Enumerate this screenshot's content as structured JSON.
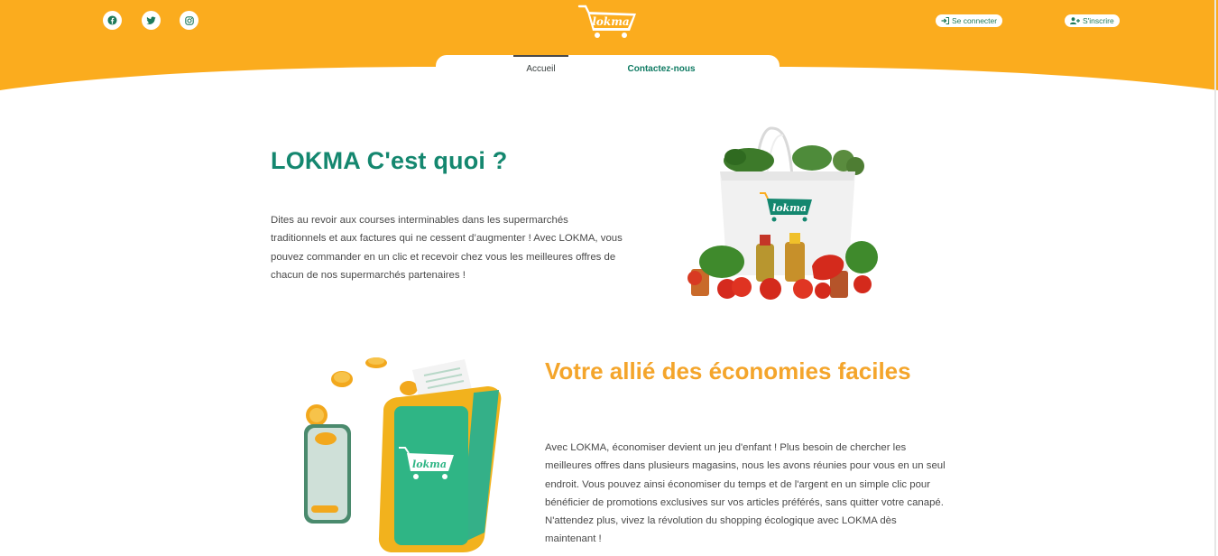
{
  "header": {
    "brand_color": "#fbac1e",
    "social": [
      {
        "icon": "facebook-icon"
      },
      {
        "icon": "twitter-icon"
      },
      {
        "icon": "instagram-icon"
      }
    ],
    "logo_text": "lokma",
    "login_label": "Se connecter",
    "signup_label": "S'inscrire"
  },
  "nav": {
    "items": [
      {
        "label": "Accueil",
        "active": true
      },
      {
        "label": "Contactez-nous",
        "active": false
      }
    ]
  },
  "section1": {
    "title": "LOKMA C'est quoi ?",
    "body": "Dites au revoir aux courses interminables dans les supermarchés traditionnels et aux factures qui ne cessent d’augmenter ! Avec LOKMA, vous pouvez commander en un clic et recevoir chez vous les meilleures offres de chacun de nos supermarchés partenaires !",
    "image_logo_text": "lokma",
    "title_color": "#14876f"
  },
  "section2": {
    "title": "Votre allié des économies faciles",
    "body": "Avec LOKMA, économiser devient un jeu d'enfant ! Plus besoin de chercher les meilleures offres dans plusieurs magasins, nous les avons réunies pour vous en un seul endroit. Vous pouvez ainsi économiser du temps et de l'argent en un simple clic pour bénéficier de promotions exclusives sur vos articles préférés, sans quitter votre canapé. N'attendez plus, vivez la révolution du shopping écologique avec LOKMA dès maintenant !",
    "image_logo_text": "lokma",
    "title_color": "#f4a52b"
  }
}
